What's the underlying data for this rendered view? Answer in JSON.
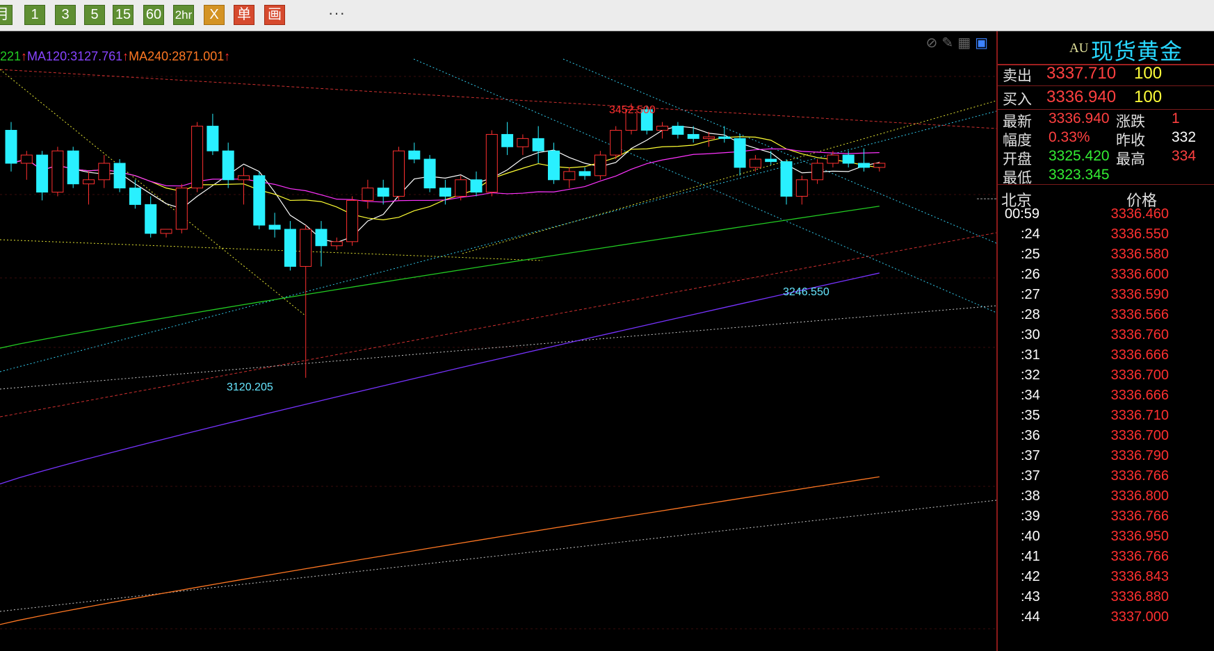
{
  "toolbar": {
    "buttons": [
      {
        "label": "月",
        "color": "green"
      },
      {
        "label": "1",
        "color": "green"
      },
      {
        "label": "3",
        "color": "green"
      },
      {
        "label": "5",
        "color": "green"
      },
      {
        "label": "15",
        "color": "green"
      },
      {
        "label": "60",
        "color": "green"
      },
      {
        "label": "2hr",
        "color": "green"
      },
      {
        "label": "X",
        "color": "orange"
      },
      {
        "label": "单",
        "color": "red"
      },
      {
        "label": "画",
        "color": "red"
      }
    ],
    "more_label": "···"
  },
  "legend": {
    "ma60_tail": "221",
    "ma60_arrow": "↑",
    "ma120": "MA120:3127.761",
    "ma120_arrow": "↑",
    "ma240": "MA240:2871.001",
    "ma240_arrow": "↑"
  },
  "annotations": {
    "high": "3452.500",
    "low1": "3120.205",
    "low2": "3246.550"
  },
  "chart_icons": [
    "eye-off-icon",
    "pencil-icon",
    "grid-icon",
    "panel-toggle-icon"
  ],
  "panel": {
    "symbol_code": "AU",
    "symbol_name": "现货黄金",
    "sell": {
      "label": "卖出",
      "price": "3337.710",
      "volume": "100"
    },
    "buy": {
      "label": "买入",
      "price": "3336.940",
      "volume": "100"
    },
    "stats": [
      {
        "label": "最新",
        "value": "3336.940",
        "value_color": "#ff4040"
      },
      {
        "label": "涨跌",
        "value": "1",
        "value_color": "#ff4040"
      },
      {
        "label": "幅度",
        "value": "0.33%",
        "value_color": "#ff4040"
      },
      {
        "label": "昨收",
        "value": "332",
        "value_color": "#ffffff"
      },
      {
        "label": "开盘",
        "value": "3325.420",
        "value_color": "#33ee33"
      },
      {
        "label": "最高",
        "value": "334",
        "value_color": "#ff4040"
      },
      {
        "label": "最低",
        "value": "3323.345",
        "value_color": "#33ee33"
      }
    ],
    "ticks_header": {
      "time": "北京",
      "price": "价格"
    },
    "ticks": [
      {
        "time": "00:59",
        "price": "3336.460"
      },
      {
        "time": ":24",
        "price": "3336.550"
      },
      {
        "time": ":25",
        "price": "3336.580"
      },
      {
        "time": ":26",
        "price": "3336.600"
      },
      {
        "time": ":27",
        "price": "3336.590"
      },
      {
        "time": ":28",
        "price": "3336.566"
      },
      {
        "time": ":30",
        "price": "3336.760"
      },
      {
        "time": ":31",
        "price": "3336.666"
      },
      {
        "time": ":32",
        "price": "3336.700"
      },
      {
        "time": ":34",
        "price": "3336.666"
      },
      {
        "time": ":35",
        "price": "3336.710"
      },
      {
        "time": ":36",
        "price": "3336.700"
      },
      {
        "time": ":37",
        "price": "3336.790"
      },
      {
        "time": ":37",
        "price": "3336.766"
      },
      {
        "time": ":38",
        "price": "3336.800"
      },
      {
        "time": ":39",
        "price": "3336.766"
      },
      {
        "time": ":40",
        "price": "3336.950"
      },
      {
        "time": ":41",
        "price": "3336.766"
      },
      {
        "time": ":42",
        "price": "3336.843"
      },
      {
        "time": ":43",
        "price": "3336.880"
      },
      {
        "time": ":44",
        "price": "3337.000"
      }
    ]
  },
  "colors": {
    "bull": "#ff3030",
    "bear": "#29f0ff",
    "ma5": "#ffffff",
    "ma10": "#ffff33",
    "ma20": "#ff33ff",
    "ma60": "#22cc22",
    "ma120": "#7733ff",
    "ma240": "#ff7722"
  },
  "candles": [
    {
      "o": 3420,
      "h": 3430,
      "l": 3370,
      "c": 3380
    },
    {
      "o": 3380,
      "h": 3395,
      "l": 3360,
      "c": 3390
    },
    {
      "o": 3390,
      "h": 3395,
      "l": 3335,
      "c": 3345
    },
    {
      "o": 3345,
      "h": 3400,
      "l": 3340,
      "c": 3395
    },
    {
      "o": 3395,
      "h": 3400,
      "l": 3350,
      "c": 3355
    },
    {
      "o": 3355,
      "h": 3370,
      "l": 3330,
      "c": 3360
    },
    {
      "o": 3360,
      "h": 3390,
      "l": 3350,
      "c": 3380
    },
    {
      "o": 3380,
      "h": 3385,
      "l": 3345,
      "c": 3350
    },
    {
      "o": 3350,
      "h": 3360,
      "l": 3325,
      "c": 3330
    },
    {
      "o": 3330,
      "h": 3340,
      "l": 3290,
      "c": 3295
    },
    {
      "o": 3295,
      "h": 3300,
      "l": 3290,
      "c": 3300
    },
    {
      "o": 3300,
      "h": 3355,
      "l": 3295,
      "c": 3350
    },
    {
      "o": 3350,
      "h": 3430,
      "l": 3345,
      "c": 3425
    },
    {
      "o": 3425,
      "h": 3440,
      "l": 3390,
      "c": 3395
    },
    {
      "o": 3395,
      "h": 3405,
      "l": 3350,
      "c": 3360
    },
    {
      "o": 3360,
      "h": 3375,
      "l": 3330,
      "c": 3365
    },
    {
      "o": 3365,
      "h": 3370,
      "l": 3300,
      "c": 3305
    },
    {
      "o": 3305,
      "h": 3320,
      "l": 3290,
      "c": 3300
    },
    {
      "o": 3300,
      "h": 3310,
      "l": 3250,
      "c": 3255
    },
    {
      "o": 3255,
      "h": 3305,
      "l": 3120,
      "c": 3300
    },
    {
      "o": 3300,
      "h": 3310,
      "l": 3255,
      "c": 3280
    },
    {
      "o": 3280,
      "h": 3290,
      "l": 3275,
      "c": 3285
    },
    {
      "o": 3285,
      "h": 3340,
      "l": 3280,
      "c": 3335
    },
    {
      "o": 3335,
      "h": 3360,
      "l": 3325,
      "c": 3350
    },
    {
      "o": 3350,
      "h": 3360,
      "l": 3330,
      "c": 3340
    },
    {
      "o": 3340,
      "h": 3400,
      "l": 3335,
      "c": 3395
    },
    {
      "o": 3395,
      "h": 3405,
      "l": 3380,
      "c": 3385
    },
    {
      "o": 3385,
      "h": 3390,
      "l": 3345,
      "c": 3350
    },
    {
      "o": 3350,
      "h": 3360,
      "l": 3330,
      "c": 3340
    },
    {
      "o": 3340,
      "h": 3365,
      "l": 3335,
      "c": 3360
    },
    {
      "o": 3360,
      "h": 3370,
      "l": 3340,
      "c": 3345
    },
    {
      "o": 3345,
      "h": 3420,
      "l": 3340,
      "c": 3415
    },
    {
      "o": 3415,
      "h": 3430,
      "l": 3390,
      "c": 3400
    },
    {
      "o": 3400,
      "h": 3415,
      "l": 3390,
      "c": 3410
    },
    {
      "o": 3410,
      "h": 3425,
      "l": 3380,
      "c": 3395
    },
    {
      "o": 3395,
      "h": 3405,
      "l": 3355,
      "c": 3360
    },
    {
      "o": 3360,
      "h": 3375,
      "l": 3350,
      "c": 3370
    },
    {
      "o": 3370,
      "h": 3375,
      "l": 3360,
      "c": 3365
    },
    {
      "o": 3365,
      "h": 3395,
      "l": 3360,
      "c": 3390
    },
    {
      "o": 3390,
      "h": 3425,
      "l": 3385,
      "c": 3420
    },
    {
      "o": 3420,
      "h": 3452.5,
      "l": 3415,
      "c": 3445
    },
    {
      "o": 3445,
      "h": 3450,
      "l": 3415,
      "c": 3420
    },
    {
      "o": 3420,
      "h": 3430,
      "l": 3410,
      "c": 3425
    },
    {
      "o": 3425,
      "h": 3430,
      "l": 3410,
      "c": 3415
    },
    {
      "o": 3415,
      "h": 3425,
      "l": 3405,
      "c": 3410
    },
    {
      "o": 3410,
      "h": 3418,
      "l": 3400,
      "c": 3412
    },
    {
      "o": 3412,
      "h": 3425,
      "l": 3405,
      "c": 3410
    },
    {
      "o": 3410,
      "h": 3415,
      "l": 3365,
      "c": 3375
    },
    {
      "o": 3375,
      "h": 3390,
      "l": 3370,
      "c": 3385
    },
    {
      "o": 3385,
      "h": 3395,
      "l": 3378,
      "c": 3382
    },
    {
      "o": 3382,
      "h": 3385,
      "l": 3330,
      "c": 3340
    },
    {
      "o": 3340,
      "h": 3365,
      "l": 3330,
      "c": 3360
    },
    {
      "o": 3360,
      "h": 3385,
      "l": 3355,
      "c": 3380
    },
    {
      "o": 3380,
      "h": 3395,
      "l": 3375,
      "c": 3390
    },
    {
      "o": 3390,
      "h": 3395,
      "l": 3375,
      "c": 3380
    },
    {
      "o": 3380,
      "h": 3398,
      "l": 3370,
      "c": 3375
    },
    {
      "o": 3375,
      "h": 3382,
      "l": 3370,
      "c": 3380
    }
  ]
}
